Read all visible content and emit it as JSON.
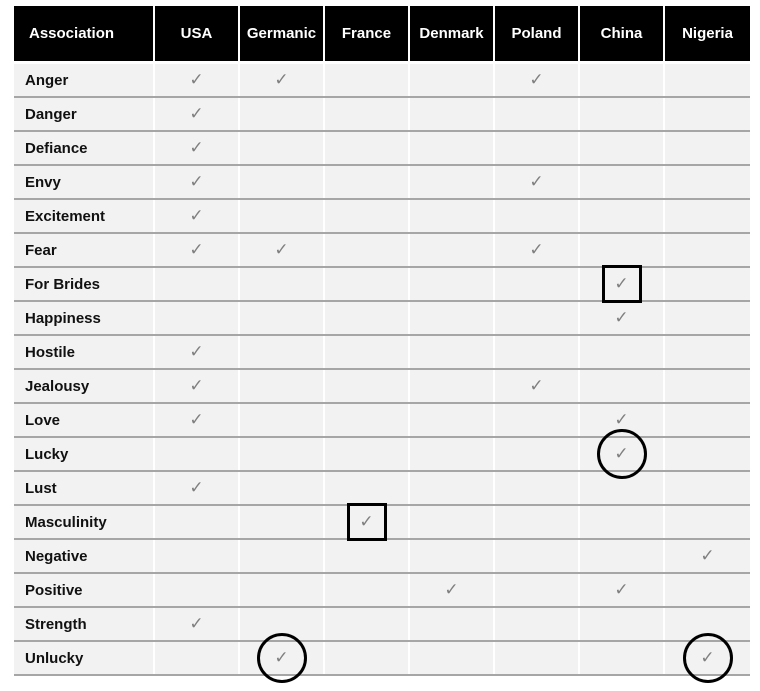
{
  "table": {
    "columns": [
      "Association",
      "USA",
      "Germanic",
      "France",
      "Denmark",
      "Poland",
      "China",
      "Nigeria"
    ],
    "check_symbol": "✓",
    "rows": [
      {
        "label": "Anger",
        "checks": [
          true,
          true,
          false,
          false,
          true,
          false,
          false
        ],
        "marks": [
          null,
          null,
          null,
          null,
          null,
          null,
          null
        ]
      },
      {
        "label": "Danger",
        "checks": [
          true,
          false,
          false,
          false,
          false,
          false,
          false
        ],
        "marks": [
          null,
          null,
          null,
          null,
          null,
          null,
          null
        ]
      },
      {
        "label": "Defiance",
        "checks": [
          true,
          false,
          false,
          false,
          false,
          false,
          false
        ],
        "marks": [
          null,
          null,
          null,
          null,
          null,
          null,
          null
        ]
      },
      {
        "label": "Envy",
        "checks": [
          true,
          false,
          false,
          false,
          true,
          false,
          false
        ],
        "marks": [
          null,
          null,
          null,
          null,
          null,
          null,
          null
        ]
      },
      {
        "label": "Excitement",
        "checks": [
          true,
          false,
          false,
          false,
          false,
          false,
          false
        ],
        "marks": [
          null,
          null,
          null,
          null,
          null,
          null,
          null
        ]
      },
      {
        "label": "Fear",
        "checks": [
          true,
          true,
          false,
          false,
          true,
          false,
          false
        ],
        "marks": [
          null,
          null,
          null,
          null,
          null,
          null,
          null
        ]
      },
      {
        "label": "For Brides",
        "checks": [
          false,
          false,
          false,
          false,
          false,
          true,
          false
        ],
        "marks": [
          null,
          null,
          null,
          null,
          null,
          "box",
          null
        ]
      },
      {
        "label": "Happiness",
        "checks": [
          false,
          false,
          false,
          false,
          false,
          true,
          false
        ],
        "marks": [
          null,
          null,
          null,
          null,
          null,
          null,
          null
        ]
      },
      {
        "label": "Hostile",
        "checks": [
          true,
          false,
          false,
          false,
          false,
          false,
          false
        ],
        "marks": [
          null,
          null,
          null,
          null,
          null,
          null,
          null
        ]
      },
      {
        "label": "Jealousy",
        "checks": [
          true,
          false,
          false,
          false,
          true,
          false,
          false
        ],
        "marks": [
          null,
          null,
          null,
          null,
          null,
          null,
          null
        ]
      },
      {
        "label": "Love",
        "checks": [
          true,
          false,
          false,
          false,
          false,
          true,
          false
        ],
        "marks": [
          null,
          null,
          null,
          null,
          null,
          null,
          null
        ]
      },
      {
        "label": "Lucky",
        "checks": [
          false,
          false,
          false,
          false,
          false,
          true,
          false
        ],
        "marks": [
          null,
          null,
          null,
          null,
          null,
          "circle",
          null
        ]
      },
      {
        "label": "Lust",
        "checks": [
          true,
          false,
          false,
          false,
          false,
          false,
          false
        ],
        "marks": [
          null,
          null,
          null,
          null,
          null,
          null,
          null
        ]
      },
      {
        "label": "Masculinity",
        "checks": [
          false,
          false,
          true,
          false,
          false,
          false,
          false
        ],
        "marks": [
          null,
          null,
          "box",
          null,
          null,
          null,
          null
        ]
      },
      {
        "label": "Negative",
        "checks": [
          false,
          false,
          false,
          false,
          false,
          false,
          true
        ],
        "marks": [
          null,
          null,
          null,
          null,
          null,
          null,
          null
        ]
      },
      {
        "label": "Positive",
        "checks": [
          false,
          false,
          false,
          true,
          false,
          true,
          false
        ],
        "marks": [
          null,
          null,
          null,
          null,
          null,
          null,
          null
        ]
      },
      {
        "label": "Strength",
        "checks": [
          true,
          false,
          false,
          false,
          false,
          false,
          false
        ],
        "marks": [
          null,
          null,
          null,
          null,
          null,
          null,
          null
        ]
      },
      {
        "label": "Unlucky",
        "checks": [
          false,
          true,
          false,
          false,
          false,
          false,
          true
        ],
        "marks": [
          null,
          "circle",
          null,
          null,
          null,
          null,
          "circle"
        ]
      }
    ]
  }
}
